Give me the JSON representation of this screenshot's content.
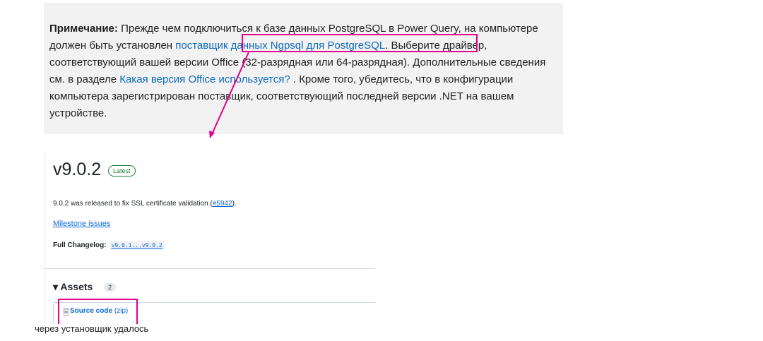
{
  "note": {
    "label": "Примечание:",
    "text_1": " Прежде чем подключиться к базе данных PostgreSQL в Power Query, на компьютере должен быть установлен ",
    "link_provider": "поставщик данных Ngpsql для PostgreSQL",
    "text_2": ". Выберите драйвер, соответствующий вашей версии Office (32-разрядная или 64-разрядная). Дополнительные сведения см. в разделе ",
    "link_office": "Какая версия Office используется?",
    "text_3": " . Кроме того, убедитесь, что в конфигурации компьютера зарегистрирован поставщик, соответствующий последней версии .NET на вашем устройстве."
  },
  "release": {
    "tag": "v9.0.2",
    "badge": "Latest",
    "desc_prefix": "9.0.2 was released to fix SSL certificate validation (",
    "issue_link": "#5942",
    "desc_suffix": ").",
    "milestone": "Milestone issues",
    "changelog_label": "Full Changelog:",
    "changelog_range": "v9.0.1...v9.0.2",
    "assets_label": "▾ Assets",
    "assets_count": "2",
    "asset_name": "Source code",
    "asset_ext": "(zip)"
  },
  "caption": "через установщик удалось",
  "colors": {
    "highlight": "#e3008c",
    "link": "#0969da",
    "note_link": "#0f6cbd",
    "note_bg": "#f2f2f2"
  },
  "icons": [
    "zip-file-icon",
    "arrow-annotation"
  ]
}
